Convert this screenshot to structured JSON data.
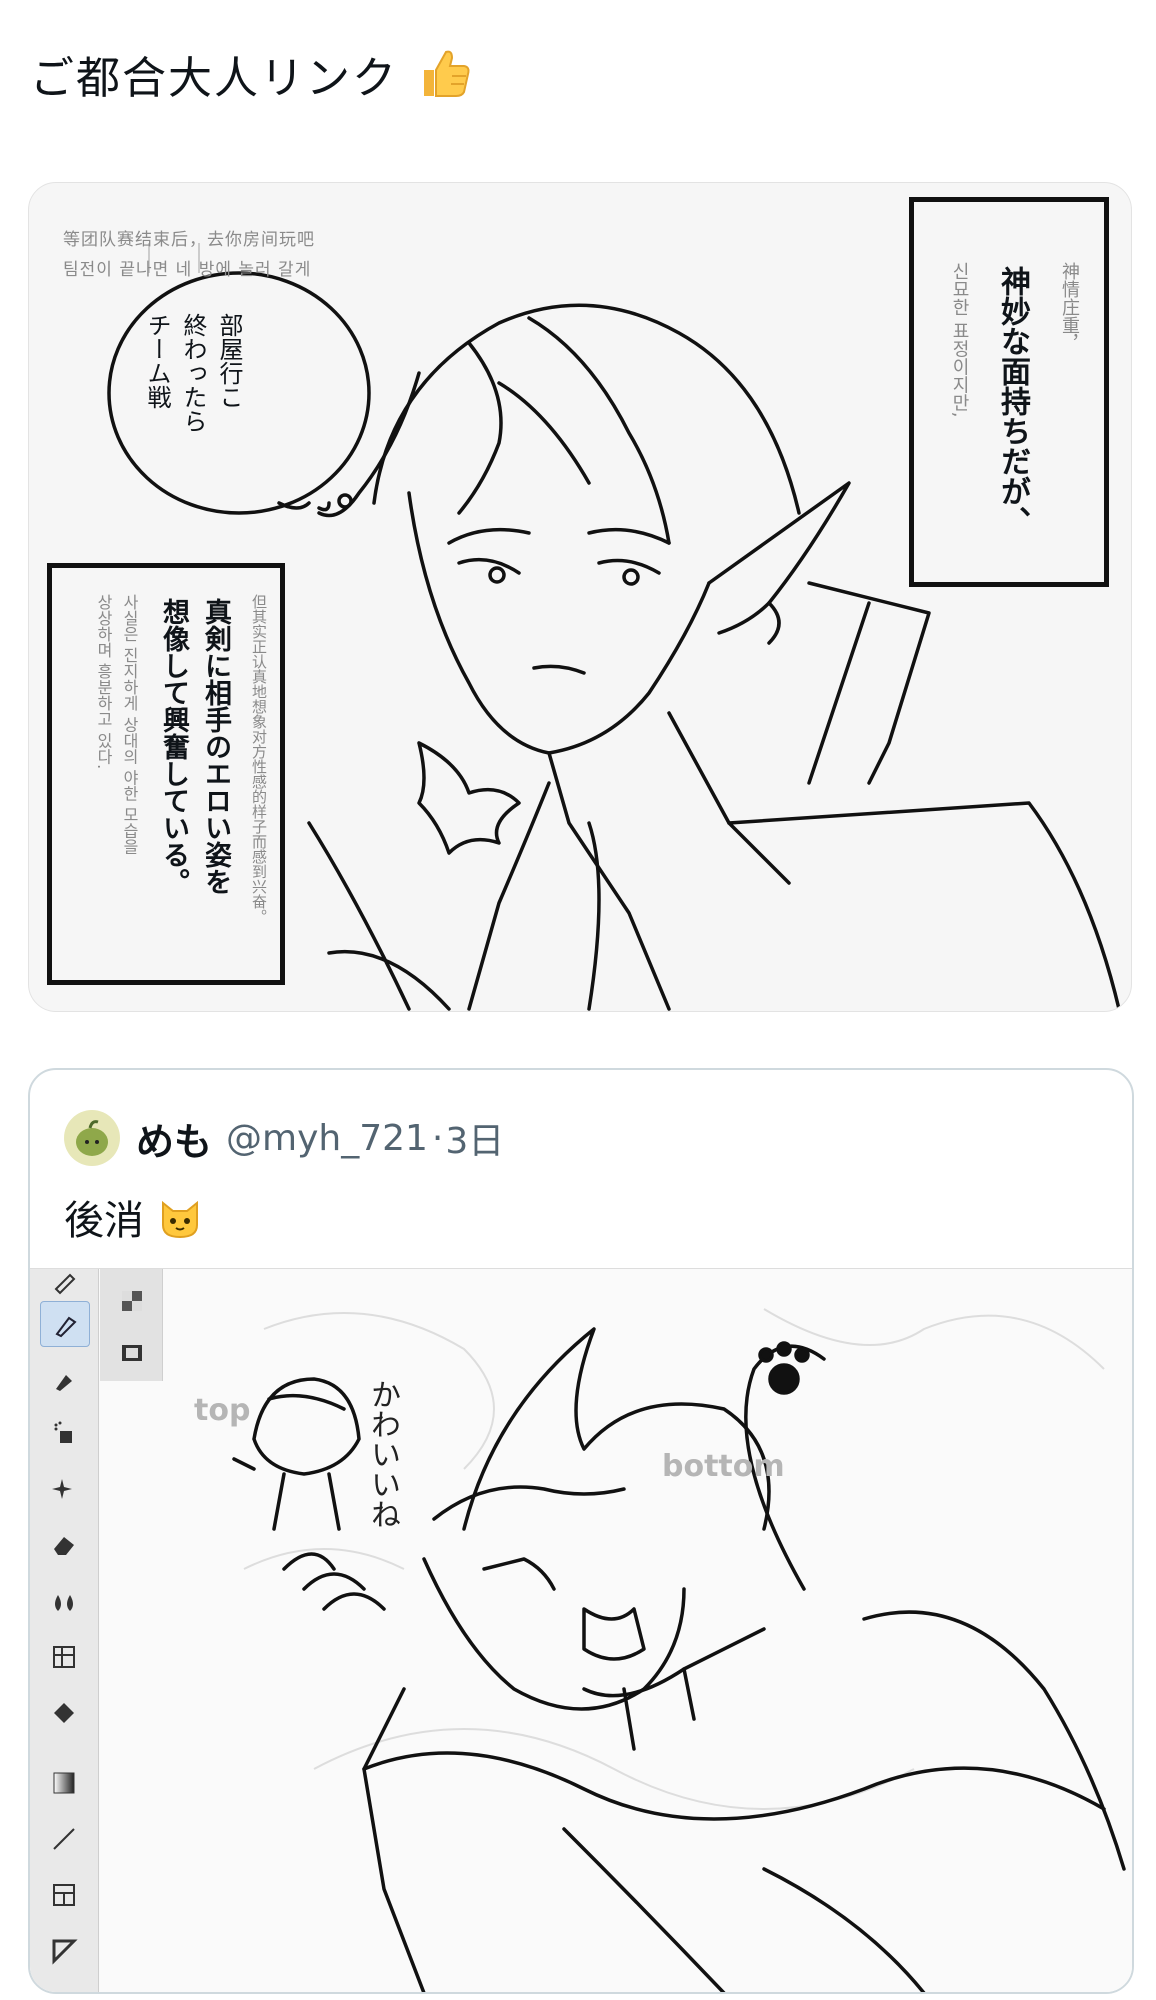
{
  "tweet": {
    "text": "ご都合大人リンク",
    "emoji_icon": "thumbs-up-icon"
  },
  "manga_panel": {
    "header_zh": "等团队赛结束后，去你房间玩吧",
    "header_ko": "팀전이 끝나면 네 방에 놀러 갈게",
    "bubble": [
      "部屋行こ",
      "終わったら",
      "チーム戦"
    ],
    "caption_right_jp": "神妙な面持ちだが、",
    "caption_right_zh": "神情庄重，",
    "caption_right_ko": "신묘한 표정이지만,",
    "caption_left_jp": [
      "真剣に相手のエロい姿を",
      "想像して興奮している。"
    ],
    "caption_left_zh": "但其实正认真地想象对方性感的样子而感到兴奋。",
    "caption_left_ko": [
      "사실은 진지하게 상대의 야한 모습을",
      "상상하며 흥분하고 있다."
    ]
  },
  "quote": {
    "avatar_icon": "green-blob-avatar-icon",
    "name": "めも",
    "handle": "@myh_721",
    "dot": "·",
    "time": "3日",
    "text": "後消",
    "text_emoji_icon": "cat-face-icon",
    "drawing": {
      "label_top": "top",
      "label_bottom": "bottom",
      "handwritten": "かわいいね"
    },
    "tools": [
      "pen-nib-icon",
      "pen-icon",
      "marker-icon",
      "airbrush-icon",
      "sparkle-icon",
      "eraser-icon",
      "blend-icon",
      "grid-transform-icon",
      "fill-bucket-icon",
      "gradient-icon",
      "line-icon",
      "frame-icon",
      "shape-icon"
    ],
    "layer_tools": [
      "layer-grid-icon",
      "film-icon"
    ]
  }
}
